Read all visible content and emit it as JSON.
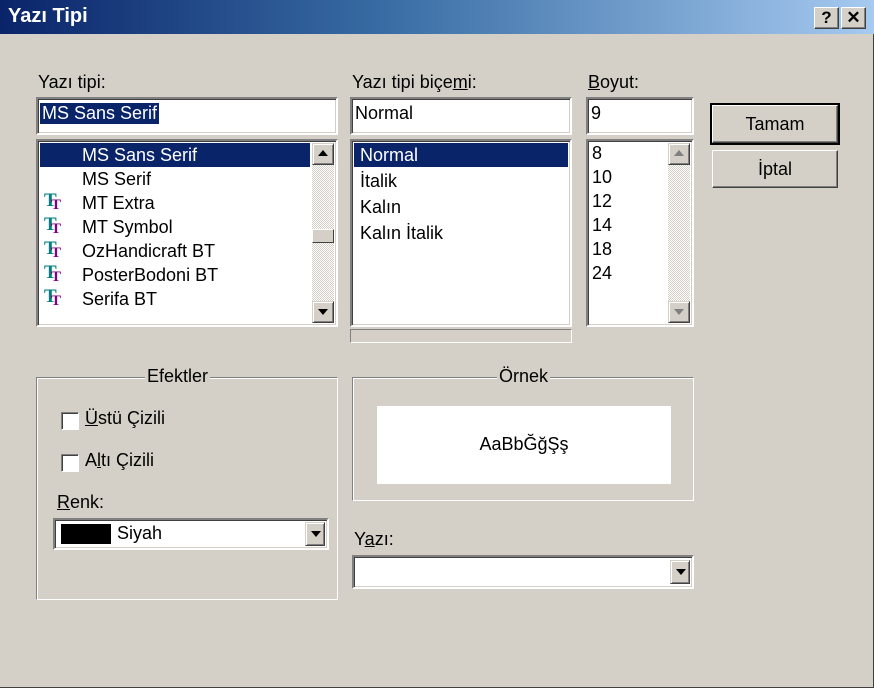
{
  "window": {
    "title": "Yazı Tipi",
    "help_label": "?",
    "close_label": "✕"
  },
  "font": {
    "label": "Yazı tipi:",
    "value": "MS Sans Serif",
    "items": [
      {
        "label": "MS Sans Serif",
        "truetype": false,
        "selected": true
      },
      {
        "label": "MS Serif",
        "truetype": false,
        "selected": false
      },
      {
        "label": "MT Extra",
        "truetype": true,
        "selected": false
      },
      {
        "label": "MT Symbol",
        "truetype": true,
        "selected": false
      },
      {
        "label": "OzHandicraft BT",
        "truetype": true,
        "selected": false
      },
      {
        "label": "PosterBodoni BT",
        "truetype": true,
        "selected": false
      },
      {
        "label": "Serifa BT",
        "truetype": true,
        "selected": false
      }
    ]
  },
  "style": {
    "label": "Yazı tipi biçemi:",
    "value": "Normal",
    "items": [
      {
        "label": "Normal",
        "selected": true
      },
      {
        "label": "İtalik",
        "selected": false
      },
      {
        "label": "Kalın",
        "selected": false
      },
      {
        "label": "Kalın İtalik",
        "selected": false
      }
    ]
  },
  "size": {
    "label": "Boyut:",
    "value": "9",
    "items": [
      "8",
      "10",
      "12",
      "14",
      "18",
      "24"
    ]
  },
  "buttons": {
    "ok": "Tamam",
    "cancel": "İptal"
  },
  "effects": {
    "title": "Efektler",
    "strikeout": {
      "label": "Üstü Çizili",
      "checked": false
    },
    "underline": {
      "label": "Altı Çizili",
      "checked": false
    },
    "color_label": "Renk:",
    "color_value": "Siyah",
    "color_swatch": "#000000"
  },
  "sample": {
    "title": "Örnek",
    "text": "AaBbĞğŞş"
  },
  "script": {
    "label": "Yazı:",
    "value": ""
  },
  "colors": {
    "selection": "#0a246a",
    "face": "#d4d0c8",
    "title_start": "#0a246a",
    "title_end": "#a6caf0"
  },
  "icons": {
    "truetype": "truetype-font-icon"
  }
}
